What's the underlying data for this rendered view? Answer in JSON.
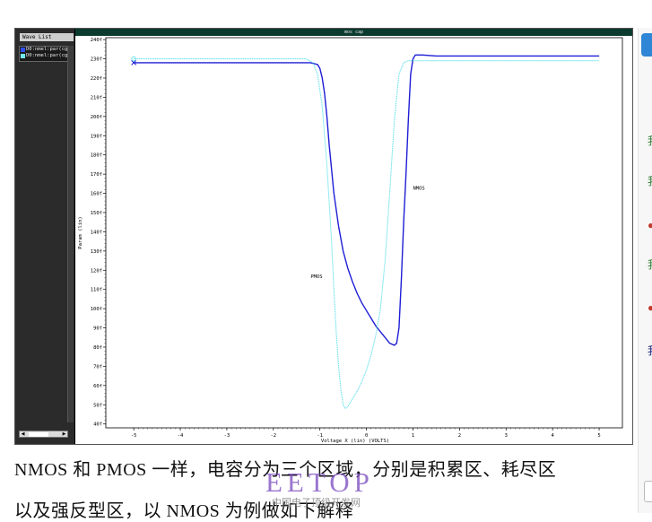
{
  "window": {
    "title": "mos cap"
  },
  "wave_list": {
    "title": "Wave List",
    "items": [
      {
        "label": "D0:nmel:par(cg)",
        "color": "#2f4fe8"
      },
      {
        "label": "D0:nmel:par(cg)",
        "color": "#6fe8f0"
      }
    ]
  },
  "chart_data": {
    "type": "line",
    "title": "",
    "xlabel": "Voltage X (lin) (VOLTS)",
    "ylabel": "Param (lin)",
    "xlim": [
      -5.6,
      5.5
    ],
    "ylim": [
      38,
      241
    ],
    "x_ticks": [
      -5,
      -4,
      -3,
      -2,
      -1,
      0,
      1,
      2,
      3,
      4,
      5
    ],
    "x_tick_labels": [
      "-5",
      "-4",
      "-3",
      "-2",
      "-1",
      "0",
      "1",
      "2",
      "3",
      "4",
      "5"
    ],
    "y_ticks": [
      40,
      50,
      60,
      70,
      80,
      90,
      100,
      110,
      120,
      130,
      140,
      150,
      160,
      170,
      180,
      190,
      200,
      210,
      220,
      230,
      240
    ],
    "y_tick_labels": [
      "40f",
      "50f",
      "60f",
      "70f",
      "80f",
      "90f",
      "100f",
      "110f",
      "120f",
      "130f",
      "140f",
      "150f",
      "160f",
      "170f",
      "180f",
      "190f",
      "200f",
      "210f",
      "220f",
      "230f",
      "240f"
    ],
    "grid": false,
    "series": [
      {
        "name": "NMOS",
        "color": "#1d1dd6",
        "style": "solid",
        "x": [
          -5,
          -4,
          -3,
          -2,
          -1.2,
          -1.05,
          -1.0,
          -0.95,
          -0.9,
          -0.85,
          -0.8,
          -0.7,
          -0.6,
          -0.5,
          -0.4,
          -0.3,
          -0.2,
          -0.1,
          0.0,
          0.1,
          0.2,
          0.3,
          0.4,
          0.5,
          0.6,
          0.65,
          0.7,
          0.75,
          0.8,
          0.85,
          0.9,
          0.95,
          1.0,
          1.05,
          1.1,
          1.2,
          1.5,
          2,
          3,
          4,
          5
        ],
        "y": [
          228,
          228,
          228,
          228,
          228,
          227,
          225,
          220,
          212,
          200,
          185,
          160,
          143,
          130,
          121,
          114,
          108,
          103,
          99,
          95,
          91,
          88,
          85,
          82,
          81,
          82,
          90,
          115,
          145,
          170,
          198,
          222,
          230,
          232,
          232,
          232,
          231.5,
          231.5,
          231.5,
          231.5,
          231.5
        ]
      },
      {
        "name": "PMOS",
        "color": "#5fe0ea",
        "style": "dotted",
        "x": [
          -5,
          -4,
          -3,
          -2,
          -1.3,
          -1.15,
          -1.05,
          -0.95,
          -0.85,
          -0.75,
          -0.7,
          -0.65,
          -0.6,
          -0.55,
          -0.5,
          -0.45,
          -0.4,
          -0.35,
          -0.3,
          -0.2,
          -0.1,
          0.0,
          0.1,
          0.2,
          0.3,
          0.4,
          0.5,
          0.6,
          0.7,
          0.8,
          0.9,
          1.0,
          1.5,
          2,
          3,
          4,
          5
        ],
        "y": [
          230,
          230,
          230,
          230,
          230,
          228,
          222,
          205,
          175,
          135,
          110,
          88,
          70,
          58,
          50,
          48,
          49,
          51,
          53,
          57,
          62,
          68,
          76,
          86,
          100,
          125,
          160,
          198,
          222,
          228,
          229,
          229,
          229,
          229,
          229,
          229,
          229
        ]
      }
    ],
    "annotations": [
      {
        "text": "NMOS",
        "x": 1.0,
        "y": 162
      },
      {
        "text": "PMOS",
        "x": -1.2,
        "y": 116
      }
    ]
  },
  "article": {
    "line1": "NMOS 和 PMOS 一样，电容分为三个区域，分别是积累区、耗尽区",
    "line2": "以及强反型区，以 NMOS 为例做如下解释"
  },
  "watermark": {
    "brand": "EETOP",
    "tagline": "中国电子顶级开发网"
  },
  "side_panel": {
    "marks": [
      {
        "symbol": "我",
        "color": "#2e7d32"
      },
      {
        "symbol": "我",
        "color": "#2e7d32"
      },
      {
        "symbol": "●",
        "color": "#c0392b"
      },
      {
        "symbol": "我",
        "color": "#2e7d32"
      },
      {
        "symbol": "●",
        "color": "#c0392b"
      },
      {
        "symbol": "我",
        "color": "#1a237e"
      }
    ]
  }
}
